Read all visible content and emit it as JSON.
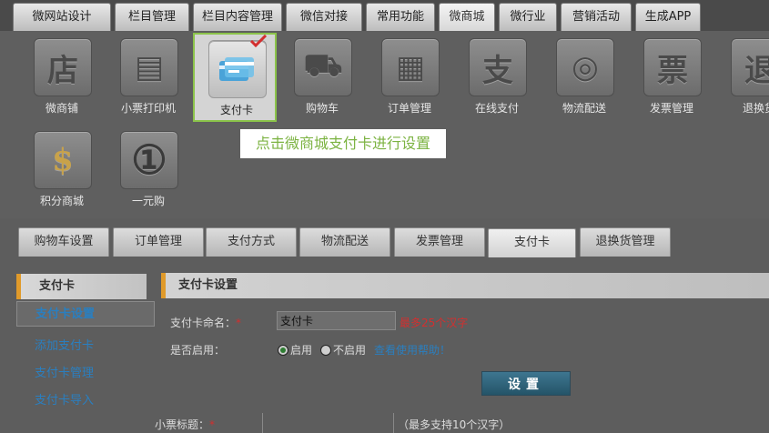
{
  "top_tabs": [
    "微网站设计",
    "栏目管理",
    "栏目内容管理",
    "微信对接",
    "常用功能",
    "微商城",
    "微行业",
    "营销活动",
    "生成APP"
  ],
  "icons": [
    {
      "label": "微商铺",
      "glyph": "店"
    },
    {
      "label": "小票打印机",
      "glyph": "▤"
    },
    {
      "label": "支付卡",
      "glyph": "▭"
    },
    {
      "label": "购物车",
      "glyph": "⛟"
    },
    {
      "label": "订单管理",
      "glyph": "▦"
    },
    {
      "label": "在线支付",
      "glyph": "支"
    },
    {
      "label": "物流配送",
      "glyph": "◎"
    },
    {
      "label": "发票管理",
      "glyph": "票"
    },
    {
      "label": "退换货",
      "glyph": "退"
    },
    {
      "label": "积分商城",
      "glyph": "$"
    },
    {
      "label": "一元购",
      "glyph": "①"
    }
  ],
  "tooltip": "点击微商城支付卡进行设置",
  "sub_tabs": [
    "购物车设置",
    "订单管理",
    "支付方式",
    "物流配送",
    "发票管理",
    "支付卡",
    "退换货管理"
  ],
  "left_nav": {
    "header": "支付卡",
    "items": [
      "支付卡设置",
      "添加支付卡",
      "支付卡管理",
      "支付卡导入"
    ]
  },
  "form": {
    "title": "支付卡设置",
    "name_label": "支付卡命名：",
    "required_mark": "*",
    "name_value": "支付卡",
    "name_hint": "最多25个汉字",
    "enable_label": "是否启用：",
    "enable_yes": "启用",
    "enable_no": "不启用",
    "help_link": "查看使用帮助！",
    "submit": "设置",
    "ticket_label": "小票标题：",
    "ticket_hint": "（最多支持10个汉字）"
  },
  "colors": {
    "accent_green": "#7cb342",
    "accent_orange": "#e09a2a",
    "link_blue": "#2a7fc0",
    "required_red": "#d32f2f"
  }
}
